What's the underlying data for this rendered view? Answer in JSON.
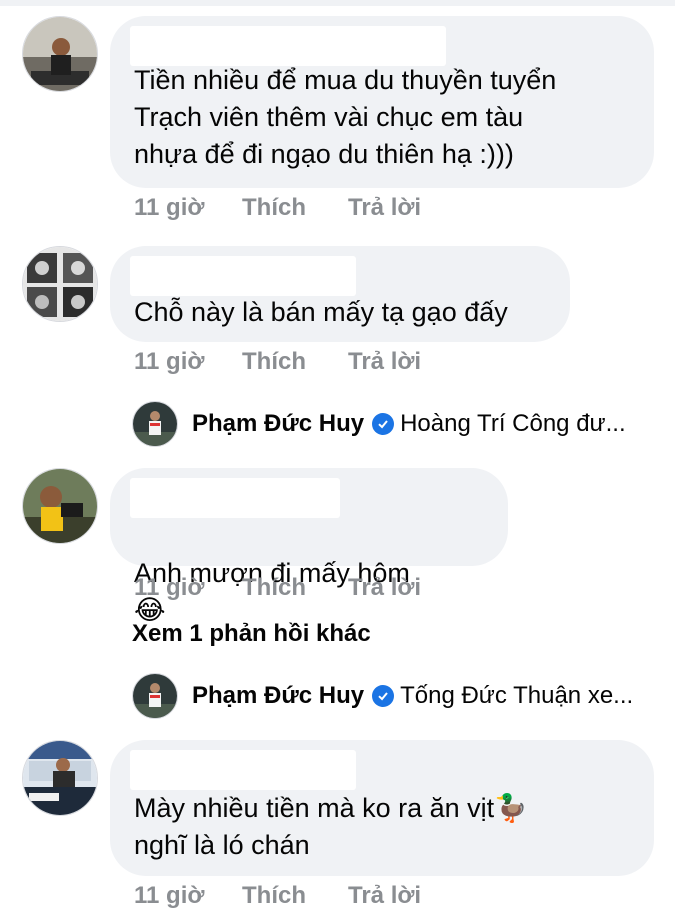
{
  "comments": [
    {
      "text": "Tiền nhiều để mua du thuyền tuyển\nTrạch viên thêm vài chục em tàu\nnhựa để đi ngạo du thiên hạ :)))",
      "time": "11 giờ",
      "like": "Thích",
      "reply": "Trả lời"
    },
    {
      "text": "Chỗ này là bán mấy tạ gạo đấy",
      "time": "11 giờ",
      "like": "Thích",
      "reply": "Trả lời"
    },
    {
      "text": "Anh mượn đi mấy hôm",
      "emoji": "😂",
      "time": "11 giờ",
      "like": "Thích",
      "reply": "Trả lời"
    },
    {
      "text": "Mày nhiều tiền mà ko ra ăn vịt🦆\nnghĩ là ló chán",
      "time": "11 giờ",
      "like": "Thích",
      "reply": "Trả lời"
    }
  ],
  "replies": [
    {
      "name": "Phạm Đức Huy",
      "preview": "Hoàng Trí Công  đư..."
    },
    {
      "name": "Phạm Đức Huy",
      "preview": "Tống Đức Thuận xe..."
    }
  ],
  "more_replies_link": "Xem 1 phản hồi khác",
  "colors": {
    "bubble": "#f0f2f5",
    "muted": "#8a8d91",
    "text": "#050505",
    "verified": "#1b74e4"
  }
}
